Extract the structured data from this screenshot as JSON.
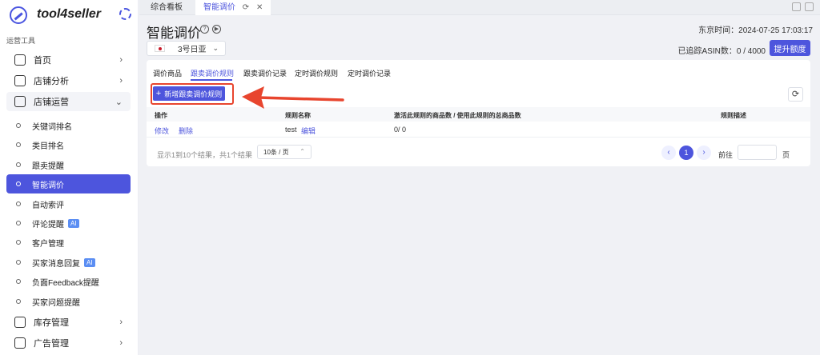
{
  "brand": {
    "name": "tool4seller"
  },
  "sidebar": {
    "section_label": "运营工具",
    "items": [
      {
        "label": "首页",
        "icon": "home-icon",
        "expandable": true
      },
      {
        "label": "店铺分析",
        "icon": "chart-icon",
        "expandable": true
      },
      {
        "label": "店铺运营",
        "icon": "store-icon",
        "expandable": true,
        "open": true
      }
    ],
    "sub_items": [
      {
        "label": "关键词排名"
      },
      {
        "label": "类目排名"
      },
      {
        "label": "跟卖提醒"
      },
      {
        "label": "智能调价",
        "active": true
      },
      {
        "label": "自动索评"
      },
      {
        "label": "评论提醒",
        "badge": "AI"
      },
      {
        "label": "客户管理"
      },
      {
        "label": "买家消息回复",
        "badge": "AI"
      },
      {
        "label": "负面Feedback提醒"
      },
      {
        "label": "买家问题提醒"
      }
    ],
    "bottom_items": [
      {
        "label": "库存管理",
        "icon": "box-icon"
      },
      {
        "label": "广告管理",
        "icon": "monitor-icon"
      }
    ]
  },
  "tabbar": {
    "tabs": [
      {
        "label": "综合看板"
      },
      {
        "label": "智能调价",
        "active": true
      }
    ]
  },
  "header": {
    "title": "智能调价",
    "marketplace": "3号日亚",
    "clock": "东京时间：2024-07-25 17:03:17",
    "quota": "已追踪ASIN数：0 / 4000",
    "upgrade_label": "提升额度"
  },
  "subtabs": [
    {
      "label": "调价商品"
    },
    {
      "label": "跟卖调价规则",
      "active": true
    },
    {
      "label": "跟卖调价记录"
    },
    {
      "label": "定时调价规则"
    },
    {
      "label": "定时调价记录"
    }
  ],
  "toolbar": {
    "add_label": "新增跟卖调价规则"
  },
  "table": {
    "headers": [
      "操作",
      "规则名称",
      "激活此规则的商品数 / 使用此规则的总商品数",
      "规则描述"
    ],
    "rows": [
      {
        "edit": "修改",
        "delete": "删除",
        "name": "test",
        "name_edit": "编辑",
        "count": "0/ 0",
        "desc": ""
      }
    ]
  },
  "pagination": {
    "info": "显示1到10个结果，共1个结果",
    "page_size": "10条 / 页",
    "current_page": "1",
    "goto_label": "前往",
    "goto_suffix": "页"
  },
  "colors": {
    "accent": "#4d55dd",
    "highlight": "#e8452e"
  }
}
